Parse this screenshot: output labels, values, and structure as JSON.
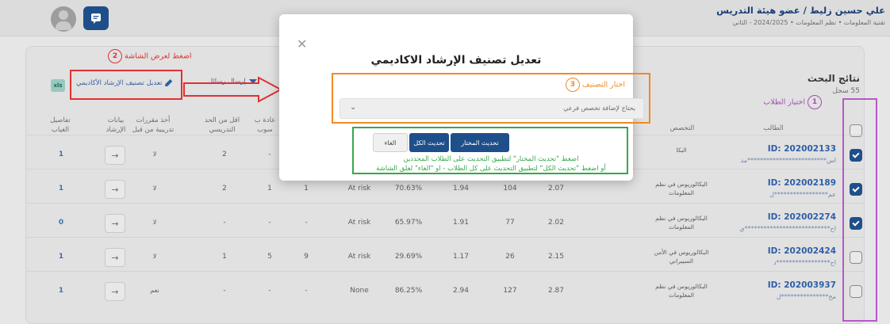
{
  "header": {
    "user_line": "علي حسين زليط / عضو هيئة التدريس",
    "sub_line": "تقنية المعلومات  •  نظم المعلومات  •  2024/2025 - الثاني"
  },
  "results": {
    "title": "نتائج البحث",
    "count": "55 سجل",
    "select_label": "اختيار الطلاب",
    "select_step": "1"
  },
  "toolbar": {
    "excel": "xls",
    "edit_label": "تعديل تصنيف الإرشاد الأكاديمي",
    "send_label": "إرسال رسائل"
  },
  "annotations": {
    "step2_num": "2",
    "step2_text": "اضغط لعرض الشاشة"
  },
  "table": {
    "headers": {
      "student": "الطالب",
      "major": "التخصص",
      "col_a": "",
      "col_b": "",
      "col_c": "",
      "col_d": "",
      "col_e": "",
      "col_f": "",
      "col_g": "",
      "col_h": "",
      "repeat": "عادة ب سوب",
      "min_level": "اقل من الحد التدريسي",
      "courses_prev": "أخذ مقررات تدريبية من قبل",
      "guidance": "بيانات الإرشاد",
      "absence": "تفاصيل الغياب"
    },
    "rows": [
      {
        "id": "ID: 202002133",
        "mask": "اس*************************مد",
        "major": "البكا",
        "c1": "",
        "c2": "",
        "c3": "",
        "c4": "",
        "c5": "",
        "c6": "",
        "rep": "-",
        "min": "2",
        "courses": "لا",
        "absence": "1",
        "checked": true
      },
      {
        "id": "ID: 202002189",
        "mask": "عم*****************ل",
        "major": "البكالوريوس في نظم المعلومات",
        "c1": "2.07",
        "c2": "104",
        "c3": "1.94",
        "c4": "70.63%",
        "c5": "At risk",
        "c6": "1",
        "rep": "1",
        "min": "2",
        "courses": "لا",
        "absence": "1",
        "checked": true
      },
      {
        "id": "ID: 202002274",
        "mask": "اح***************************ي",
        "major": "البكالوريوس في نظم المعلومات",
        "c1": "2.02",
        "c2": "77",
        "c3": "1.91",
        "c4": "65.97%",
        "c5": "At risk",
        "c6": "-",
        "rep": "-",
        "min": "-",
        "courses": "لا",
        "absence": "0",
        "checked": true
      },
      {
        "id": "ID: 202002424",
        "mask": "اح*****************د",
        "major": "البكالوريوس في الأمن السيبراني",
        "c1": "2.15",
        "c2": "26",
        "c3": "1.17",
        "c4": "29.69%",
        "c5": "At risk",
        "c6": "9",
        "rep": "5",
        "min": "1",
        "courses": "لا",
        "absence": "1",
        "checked": false
      },
      {
        "id": "ID: 202003937",
        "mask": "مح***************ل",
        "major": "البكالوريوس في نظم المعلومات",
        "c1": "2.87",
        "c2": "127",
        "c3": "2.94",
        "c4": "86.25%",
        "c5": "None",
        "c6": "-",
        "rep": "-",
        "min": "-",
        "courses": "نعم",
        "absence": "1",
        "checked": false
      }
    ]
  },
  "modal": {
    "title": "تعديل تصنيف الإرشاد الاكاديمي",
    "step3_num": "3",
    "classification_label": "اختار التصنيف",
    "classification_value": "يحتاج لإضافة تخصص فرعي",
    "btn_update_selected": "تحديث المختار",
    "btn_update_all": "تحديث الكل",
    "btn_cancel": "الغاء",
    "note_line1": "اضغط \"تحديث المختار\" لتطبيق التحديث على الطلاب المحددين",
    "note_line2": "أو اضغط \"تحديث الكل\" لتطبيق التحديث على كل الطلاب  - او \"الغاء\" لغلق الشاشة"
  },
  "colors": {
    "primary": "#1f4f8a",
    "annotation_red": "#e03131",
    "annotation_orange": "#f08a24",
    "annotation_green": "#35a84a",
    "annotation_purple": "#b659c8"
  }
}
